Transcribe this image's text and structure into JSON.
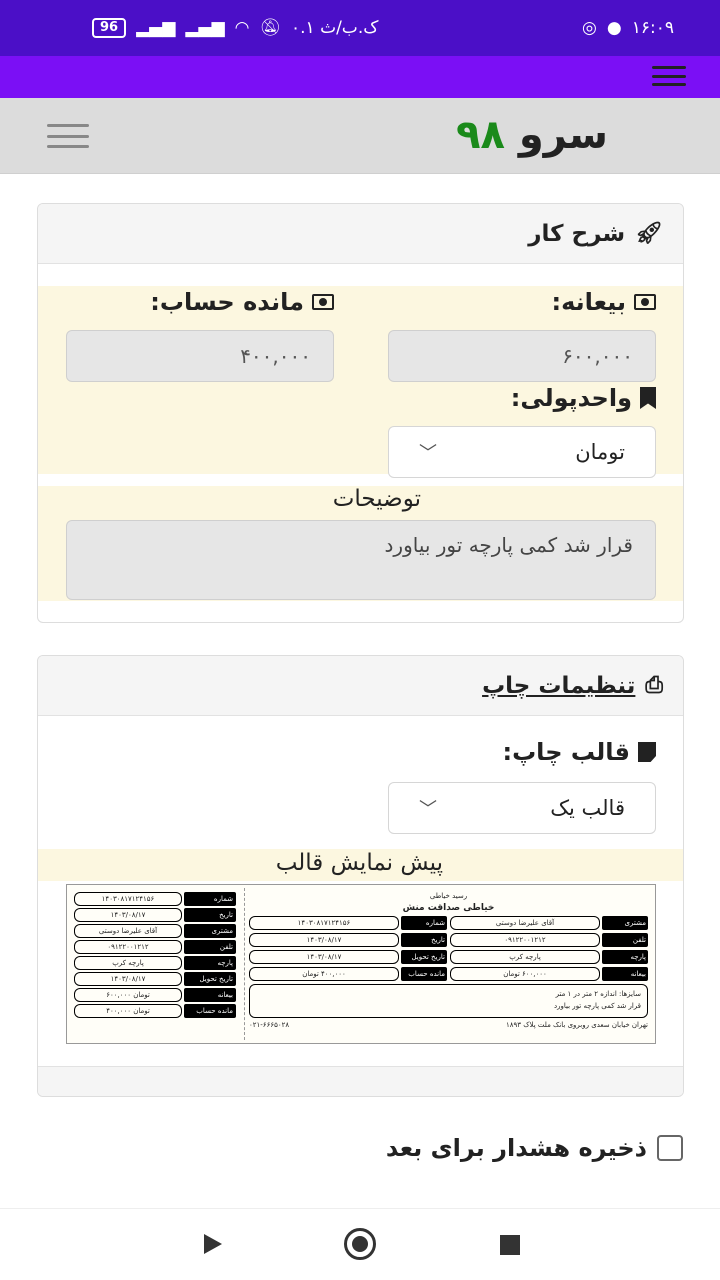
{
  "status_bar": {
    "battery": "96",
    "carrier_speed": "۰.۱ ک.ب/ث",
    "time": "۱۶:۰۹"
  },
  "app": {
    "logo_word": "سرو",
    "logo_number": "۹۸"
  },
  "job_card": {
    "title": "شرح کار",
    "deposit_label": "بیعانه:",
    "deposit_value": "۶۰۰,۰۰۰",
    "balance_label": "مانده حساب:",
    "balance_value": "۴۰۰,۰۰۰",
    "currency_label": "واحدپولی:",
    "currency_value": "تومان",
    "notes_label": "توضیحات",
    "notes_value": "قرار شد کمی پارچه تور بیاورد"
  },
  "print_card": {
    "title": "تنظیمات چاپ",
    "template_label": "قالب چاپ:",
    "template_value": "قالب یک",
    "preview_label": "پیش نمایش قالب",
    "preview": {
      "shop_subtitle": "رسید خیاطی",
      "shop_name": "خیاطی صداقت منش",
      "fields": {
        "customer_key": "مشتری",
        "customer_val": "آقای علیرضا دوستی",
        "number_key": "شماره",
        "number_val": "۱۴۰۳۰۸۱۷۱۲۴۱۵۶",
        "phone_key": "تلفن",
        "phone_val": "۰۹۱۲۲۰۰۱۲۱۲",
        "date_key": "تاریخ",
        "date_val": "۱۴۰۳/۰۸/۱۷",
        "fabric_key": "پارچه",
        "fabric_val": "پارچه کرپ",
        "delivery_key": "تاریخ تحویل",
        "delivery_val": "۱۴۰۳/۰۸/۱۷",
        "deposit_key": "بیعانه",
        "deposit_val": "۶۰۰,۰۰۰ تومان",
        "balance_key": "مانده حساب",
        "balance_val": "۴۰۰,۰۰۰ تومان"
      },
      "note_line1": "سایزها: اندازه ۲ متر در ۱ متر",
      "note_line2": "قرار شد کمی پارچه تور بیاورد",
      "address": "تهران خیابان سعدی روبروی بانک ملت پلاک ۱۸۹۳",
      "phone": "۰۲۱-۶۶۶۵۰۲۸"
    }
  },
  "save_warning_label": "ذخیره هشدار برای بعد",
  "colors": {
    "status_bar": "#4b0fc7",
    "toolbar": "#7b0ff5",
    "logo_number": "#1a8a1a",
    "cream": "#fcf7e0"
  }
}
